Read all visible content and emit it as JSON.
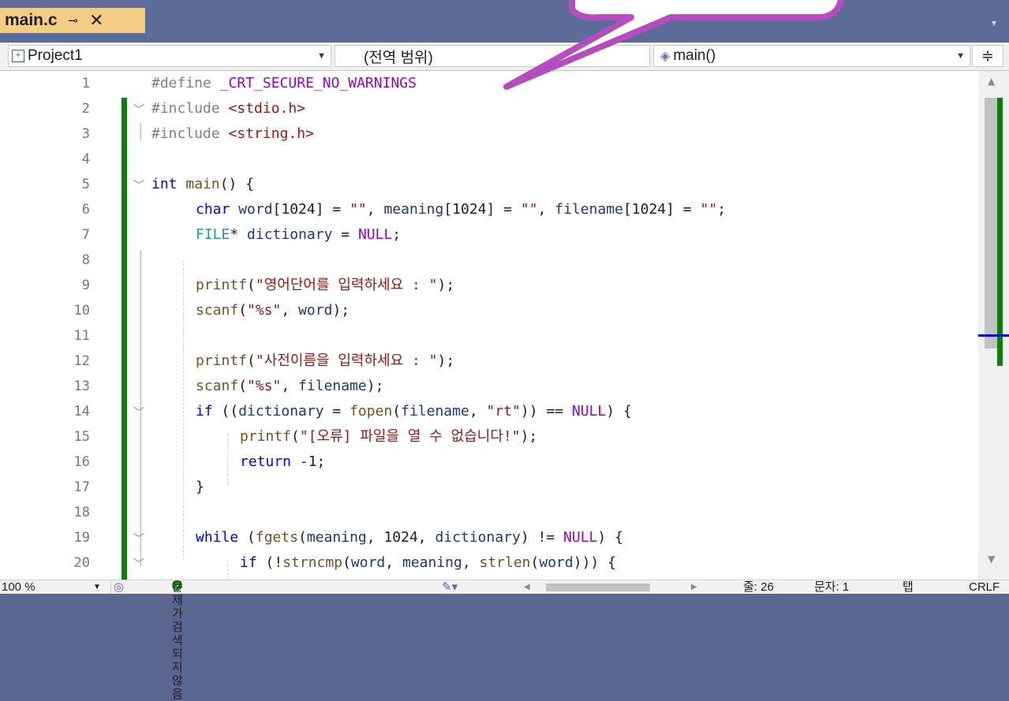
{
  "tab": {
    "filename": "main.c",
    "pin_icon": "⊸",
    "close_icon": "✕",
    "overflow_icon": "▾"
  },
  "nav": {
    "project": "Project1",
    "scope": "(전역 범위)",
    "member": "main()",
    "split_icon": "≑"
  },
  "code_lines": [
    {
      "n": "1"
    },
    {
      "n": "2"
    },
    {
      "n": "3"
    },
    {
      "n": "4"
    },
    {
      "n": "5"
    },
    {
      "n": "6"
    },
    {
      "n": "7"
    },
    {
      "n": "8"
    },
    {
      "n": "9"
    },
    {
      "n": "10"
    },
    {
      "n": "11"
    },
    {
      "n": "12"
    },
    {
      "n": "13"
    },
    {
      "n": "14"
    },
    {
      "n": "15"
    },
    {
      "n": "16"
    },
    {
      "n": "17"
    },
    {
      "n": "18"
    },
    {
      "n": "19"
    },
    {
      "n": "20"
    }
  ],
  "code": {
    "l1a": "#define ",
    "l1b": "_CRT_SECURE_NO_WARNINGS",
    "l2a": "#include ",
    "l2b": "<stdio.h>",
    "l3a": "#include ",
    "l3b": "<string.h>",
    "l5a": "int ",
    "l5b": "main",
    "l5c": "() {",
    "l6a": "char ",
    "l6b": "word",
    "l6c": "[1024] = ",
    "l6d": "\"\"",
    "l6e": ", ",
    "l6f": "meaning",
    "l6g": "[1024] = ",
    "l6h": "\"\"",
    "l6i": ", ",
    "l6j": "filename",
    "l6k": "[1024] = ",
    "l6l": "\"\"",
    "l6m": ";",
    "l7a": "FILE",
    "l7b": "* ",
    "l7c": "dictionary",
    "l7d": " = ",
    "l7e": "NULL",
    "l7f": ";",
    "l9a": "printf",
    "l9b": "(",
    "l9c": "\"영어단어를 입력하세요 : \"",
    "l9d": ");",
    "l10a": "scanf",
    "l10b": "(",
    "l10c": "\"%s\"",
    "l10d": ", ",
    "l10e": "word",
    "l10f": ");",
    "l12a": "printf",
    "l12b": "(",
    "l12c": "\"사전이름을 입력하세요 : \"",
    "l12d": ");",
    "l13a": "scanf",
    "l13b": "(",
    "l13c": "\"%s\"",
    "l13d": ", ",
    "l13e": "filename",
    "l13f": ");",
    "l14a": "if ",
    "l14b": "((",
    "l14c": "dictionary",
    "l14d": " = ",
    "l14e": "fopen",
    "l14f": "(",
    "l14g": "filename",
    "l14h": ", ",
    "l14i": "\"rt\"",
    "l14j": ")) == ",
    "l14k": "NULL",
    "l14l": ") {",
    "l15a": "printf",
    "l15b": "(",
    "l15c": "\"[오류] 파일을 열 수 없습니다!\"",
    "l15d": ");",
    "l16a": "return ",
    "l16b": "-1;",
    "l17a": "}",
    "l19a": "while ",
    "l19b": "(",
    "l19c": "fgets",
    "l19d": "(",
    "l19e": "meaning",
    "l19f": ", 1024, ",
    "l19g": "dictionary",
    "l19h": ") != ",
    "l19i": "NULL",
    "l19j": ") {",
    "l20a": "if ",
    "l20b": "(!",
    "l20c": "strncmp",
    "l20d": "(",
    "l20e": "word",
    "l20f": ", ",
    "l20g": "meaning",
    "l20h": ", ",
    "l20i": "strlen",
    "l20j": "(",
    "l20k": "word",
    "l20l": "))) {"
  },
  "status": {
    "zoom": "100 %",
    "issues": "문제가 검색되지 않음",
    "line": "줄: 26",
    "char": "문자: 1",
    "tabs": "탭",
    "eol": "CRLF"
  },
  "colors": {
    "keyword": "#0000ff",
    "string": "#a31515",
    "preprocessor": "#808080",
    "macro": "#8f08c4",
    "change_bar": "#107c10",
    "tab_active": "#f5cc84",
    "frame": "#5d6b99"
  }
}
